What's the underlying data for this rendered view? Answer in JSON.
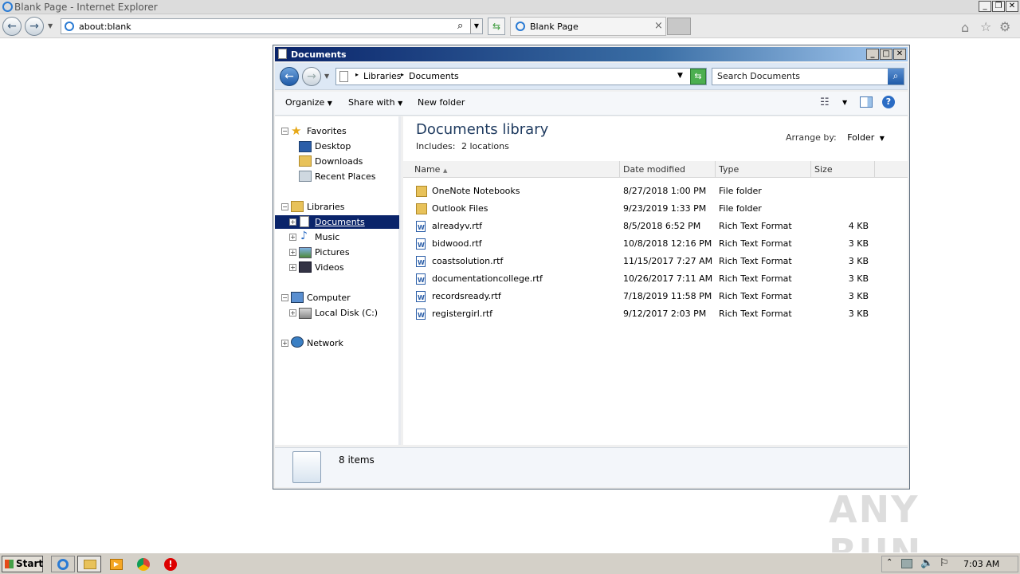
{
  "ie": {
    "title": "Blank Page - Internet Explorer",
    "address": "about:blank",
    "tab_title": "Blank Page",
    "tab_close": "×"
  },
  "explorer": {
    "title": "Documents",
    "breadcrumb": [
      "Libraries",
      "Documents"
    ],
    "search_placeholder": "Search Documents",
    "commands": {
      "organize": "Organize",
      "share": "Share with",
      "new_folder": "New folder"
    },
    "nav": {
      "favorites": "Favorites",
      "desktop": "Desktop",
      "downloads": "Downloads",
      "recent": "Recent Places",
      "libraries": "Libraries",
      "documents": "Documents",
      "music": "Music",
      "pictures": "Pictures",
      "videos": "Videos",
      "computer": "Computer",
      "local_disk": "Local Disk (C:)",
      "network": "Network"
    },
    "library_title": "Documents library",
    "includes_label": "Includes:",
    "includes_value": "2 locations",
    "arrange_label": "Arrange by:",
    "arrange_value": "Folder",
    "columns": {
      "name": "Name",
      "date": "Date modified",
      "type": "Type",
      "size": "Size"
    },
    "files": [
      {
        "name": "OneNote Notebooks",
        "date": "8/27/2018 1:00 PM",
        "type": "File folder",
        "size": "",
        "kind": "folder"
      },
      {
        "name": "Outlook Files",
        "date": "9/23/2019 1:33 PM",
        "type": "File folder",
        "size": "",
        "kind": "folder"
      },
      {
        "name": "alreadyv.rtf",
        "date": "8/5/2018 6:52 PM",
        "type": "Rich Text Format",
        "size": "4 KB",
        "kind": "rtf"
      },
      {
        "name": "bidwood.rtf",
        "date": "10/8/2018 12:16 PM",
        "type": "Rich Text Format",
        "size": "3 KB",
        "kind": "rtf"
      },
      {
        "name": "coastsolution.rtf",
        "date": "11/15/2017 7:27 AM",
        "type": "Rich Text Format",
        "size": "3 KB",
        "kind": "rtf"
      },
      {
        "name": "documentationcollege.rtf",
        "date": "10/26/2017 7:11 AM",
        "type": "Rich Text Format",
        "size": "3 KB",
        "kind": "rtf"
      },
      {
        "name": "recordsready.rtf",
        "date": "7/18/2019 11:58 PM",
        "type": "Rich Text Format",
        "size": "3 KB",
        "kind": "rtf"
      },
      {
        "name": "registergirl.rtf",
        "date": "9/12/2017 2:03 PM",
        "type": "Rich Text Format",
        "size": "3 KB",
        "kind": "rtf"
      }
    ],
    "item_count": "8 items"
  },
  "taskbar": {
    "start": "Start",
    "clock": "7:03 AM"
  },
  "watermark": "ANY RUN",
  "colors": {
    "selection": "#0a246a",
    "folder": "#e8c25a",
    "title_gradient_start": "#0a246a"
  }
}
